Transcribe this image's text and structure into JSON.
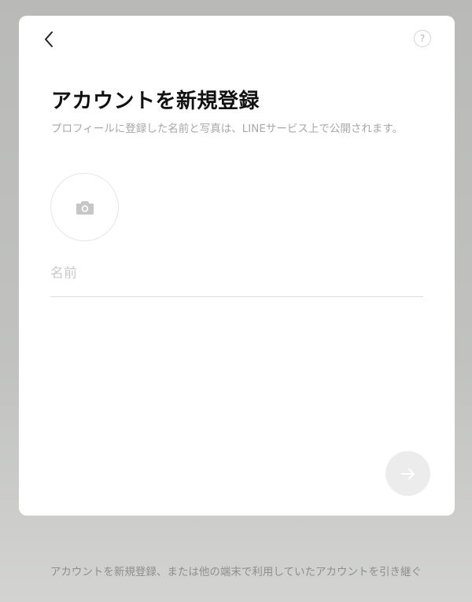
{
  "dialog": {
    "title": "アカウントを新規登録",
    "subtitle": "プロフィールに登録した名前と写真は、LINEサービス上で公開されます。",
    "help_label": "?",
    "name_placeholder": "名前",
    "icons": {
      "back": "chevron-left-icon",
      "help": "question-icon",
      "photo": "camera-icon",
      "next": "arrow-right-icon"
    }
  },
  "footer": {
    "text": "アカウントを新規登録、または他の端末で利用していたアカウントを引き継ぐ"
  },
  "colors": {
    "overlay": "#bdbebc",
    "card": "#ffffff",
    "title": "#111111",
    "muted_text": "#a7a7a7",
    "next_button_disabled": "#ececec"
  }
}
